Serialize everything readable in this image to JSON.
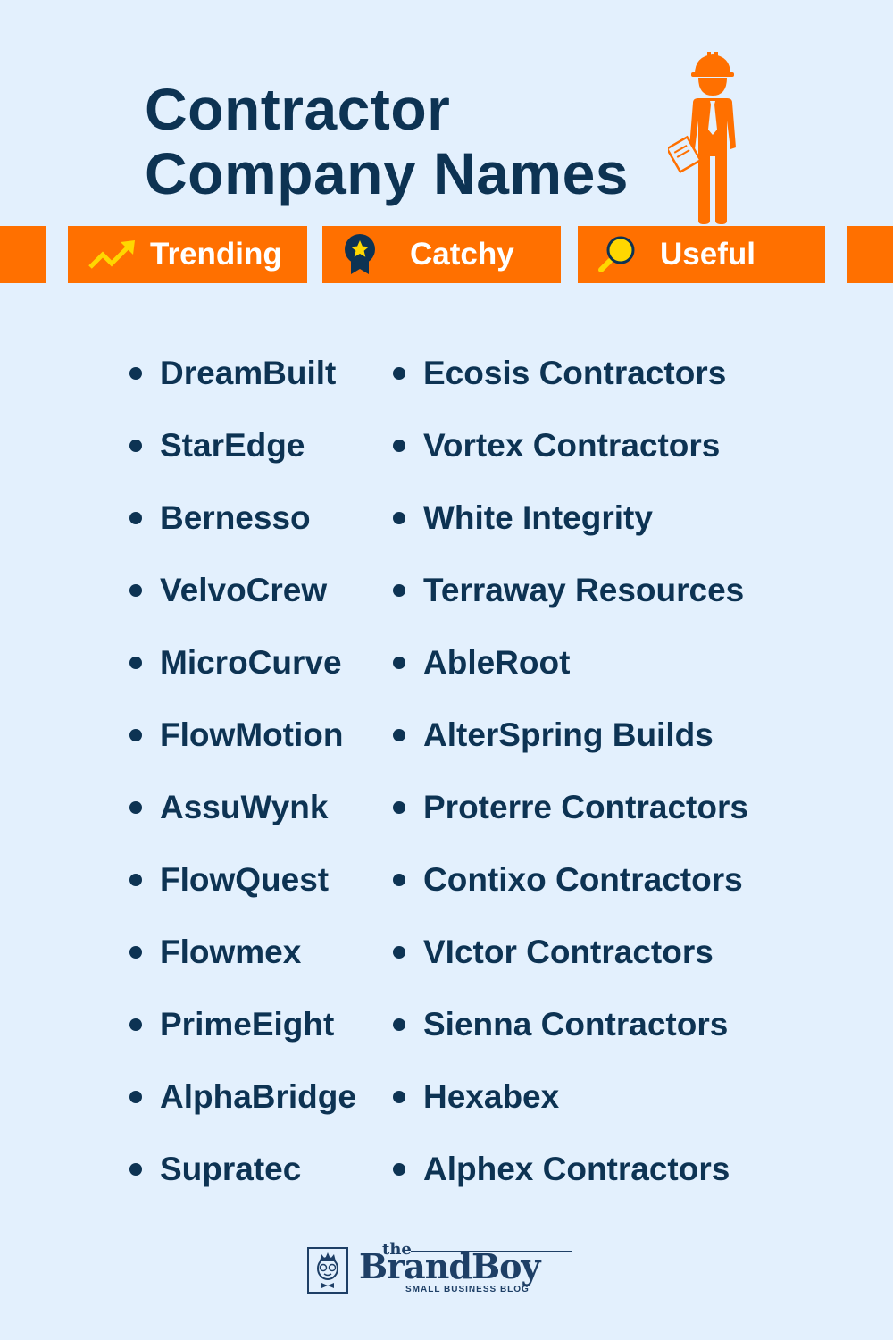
{
  "header": {
    "title_line1": "Contractor",
    "title_line2": "Company Names",
    "illustration": "contractor-worker-icon"
  },
  "colors": {
    "background": "#e3f0fd",
    "accent": "#ff7000",
    "text": "#0d3353",
    "icon_yellow": "#ffd700"
  },
  "tags": [
    {
      "label": "Trending",
      "icon": "trending-up-icon"
    },
    {
      "label": "Catchy",
      "icon": "award-badge-icon"
    },
    {
      "label": "Useful",
      "icon": "magnifier-icon"
    }
  ],
  "names": {
    "left": [
      "DreamBuilt",
      "StarEdge",
      "Bernesso",
      "VelvoCrew",
      "MicroCurve",
      "FlowMotion",
      "AssuWynk",
      "FlowQuest",
      "Flowmex",
      "PrimeEight",
      "AlphaBridge",
      "Supratec"
    ],
    "right": [
      "Ecosis Contractors",
      "Vortex Contractors",
      "White Integrity",
      "Terraway Resources",
      "AbleRoot",
      "AlterSpring Builds",
      "Proterre Contractors",
      "Contixo Contractors",
      "VIctor Contractors",
      "Sienna Contractors",
      "Hexabex",
      "Alphex Contractors"
    ]
  },
  "footer": {
    "logo_the": "the",
    "logo_brand": "BrandBoy",
    "logo_tagline": "SMALL BUSINESS BLOG"
  }
}
